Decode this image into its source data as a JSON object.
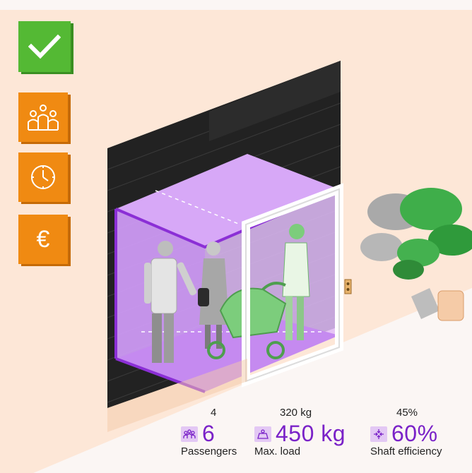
{
  "controls": {
    "confirm_icon": "check-icon",
    "people_icon": "people-icon",
    "clock_icon": "clock-icon",
    "euro_label": "€"
  },
  "stats": {
    "passengers": {
      "previous": "4",
      "value": "6",
      "label": "Passengers"
    },
    "max_load": {
      "previous": "320 kg",
      "value": "450 kg",
      "label": "Max. load"
    },
    "shaft_efficiency": {
      "previous": "45%",
      "value": "60%",
      "label": "Shaft efficiency"
    }
  },
  "colors": {
    "accent_purple": "#7a22c8",
    "cabin_purple": "#d7a8f7",
    "confirm_green": "#54b934",
    "option_orange": "#f08a12",
    "wall_peach": "#fde7d7"
  }
}
